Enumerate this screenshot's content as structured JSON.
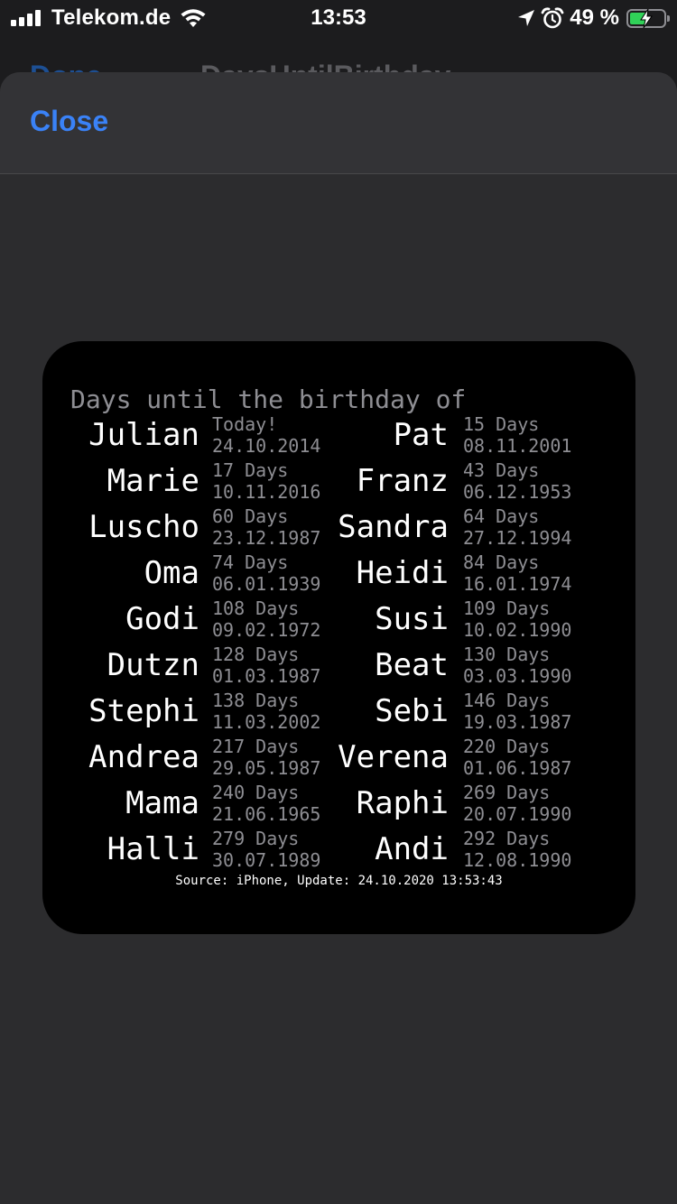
{
  "status_bar": {
    "carrier": "Telekom.de",
    "time": "13:53",
    "battery_percent": "49 %",
    "battery_level": 0.49,
    "icons": [
      "signal-bars-icon",
      "wifi-icon",
      "location-arrow-icon",
      "alarm-icon",
      "battery-charging-icon"
    ]
  },
  "background_nav": {
    "left": "Done",
    "title": "DaysUntilBirthday"
  },
  "sheet": {
    "close_label": "Close"
  },
  "widget": {
    "title": "Days until the birthday of",
    "rows": [
      {
        "left": {
          "name": "Julian",
          "days": "Today!",
          "date": "24.10.2014"
        },
        "right": {
          "name": "Pat",
          "days": "15 Days",
          "date": "08.11.2001"
        }
      },
      {
        "left": {
          "name": "Marie",
          "days": "17 Days",
          "date": "10.11.2016"
        },
        "right": {
          "name": "Franz",
          "days": "43 Days",
          "date": "06.12.1953"
        }
      },
      {
        "left": {
          "name": "Luscho",
          "days": "60 Days",
          "date": "23.12.1987"
        },
        "right": {
          "name": "Sandra",
          "days": "64 Days",
          "date": "27.12.1994"
        }
      },
      {
        "left": {
          "name": "Oma",
          "days": "74 Days",
          "date": "06.01.1939"
        },
        "right": {
          "name": "Heidi",
          "days": "84 Days",
          "date": "16.01.1974"
        }
      },
      {
        "left": {
          "name": "Godi",
          "days": "108 Days",
          "date": "09.02.1972"
        },
        "right": {
          "name": "Susi",
          "days": "109 Days",
          "date": "10.02.1990"
        }
      },
      {
        "left": {
          "name": "Dutzn",
          "days": "128 Days",
          "date": "01.03.1987"
        },
        "right": {
          "name": "Beat",
          "days": "130 Days",
          "date": "03.03.1990"
        }
      },
      {
        "left": {
          "name": "Stephi",
          "days": "138 Days",
          "date": "11.03.2002"
        },
        "right": {
          "name": "Sebi",
          "days": "146 Days",
          "date": "19.03.1987"
        }
      },
      {
        "left": {
          "name": "Andrea",
          "days": "217 Days",
          "date": "29.05.1987"
        },
        "right": {
          "name": "Verena",
          "days": "220 Days",
          "date": "01.06.1987"
        }
      },
      {
        "left": {
          "name": "Mama",
          "days": "240 Days",
          "date": "21.06.1965"
        },
        "right": {
          "name": "Raphi",
          "days": "269 Days",
          "date": "20.07.1990"
        }
      },
      {
        "left": {
          "name": "Halli",
          "days": "279 Days",
          "date": "30.07.1989"
        },
        "right": {
          "name": "Andi",
          "days": "292 Days",
          "date": "12.08.1990"
        }
      }
    ],
    "footer": "Source: iPhone, Update: 24.10.2020 13:53:43"
  },
  "colors": {
    "accent": "#3a82f7",
    "battery": "#30d158",
    "sheet_bg": "#2c2c2e",
    "widget_bg": "#000000",
    "secondary_text": "#8e8e93"
  }
}
